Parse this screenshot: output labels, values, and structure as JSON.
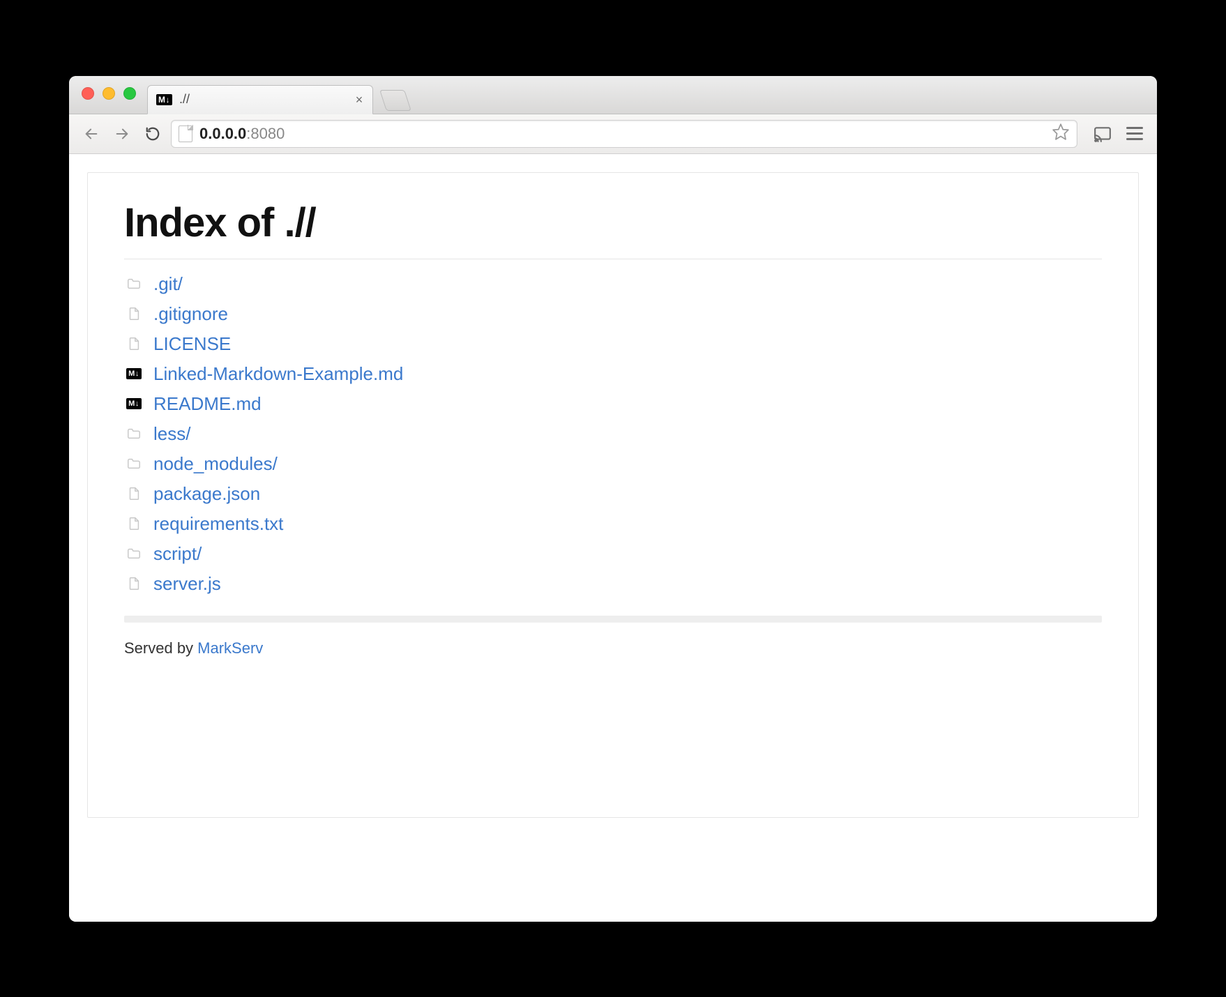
{
  "window": {
    "tab_title": ".//",
    "tab_badge": "M↓"
  },
  "toolbar": {
    "url_host": "0.0.0.0",
    "url_port": ":8080"
  },
  "page": {
    "heading": "Index of .//",
    "entries": [
      {
        "name": ".git/",
        "type": "folder"
      },
      {
        "name": ".gitignore",
        "type": "file"
      },
      {
        "name": "LICENSE",
        "type": "file"
      },
      {
        "name": "Linked-Markdown-Example.md",
        "type": "markdown"
      },
      {
        "name": "README.md",
        "type": "markdown"
      },
      {
        "name": "less/",
        "type": "folder"
      },
      {
        "name": "node_modules/",
        "type": "folder"
      },
      {
        "name": "package.json",
        "type": "file"
      },
      {
        "name": "requirements.txt",
        "type": "file"
      },
      {
        "name": "script/",
        "type": "folder"
      },
      {
        "name": "server.js",
        "type": "file"
      }
    ],
    "footer_prefix": "Served by ",
    "footer_link": "MarkServ"
  },
  "icons": {
    "close": "×"
  }
}
